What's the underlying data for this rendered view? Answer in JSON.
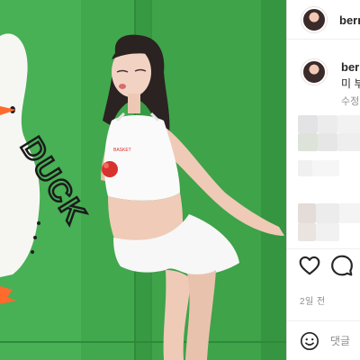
{
  "post": {
    "username": "berr",
    "caption": "미 부",
    "edited_label": "수정",
    "time_ago": "2일 전"
  },
  "photo": {
    "wall_text": "DUCK",
    "shirt_text": "BASKET",
    "wall_color": "#3fa64a"
  },
  "actions": {
    "like_icon": "heart-outline-icon",
    "comment_icon": "speech-bubble-icon"
  },
  "add_comment": {
    "emoji_icon": "smiley-icon",
    "placeholder": "댓글"
  },
  "colors": {
    "text_primary": "#262626",
    "text_secondary": "#8e8e8e",
    "border": "#dbdbdb"
  }
}
